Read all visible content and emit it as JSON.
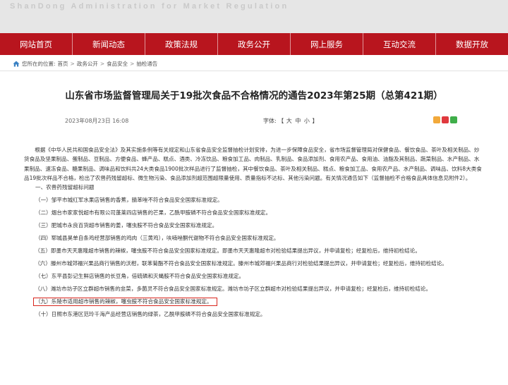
{
  "header": {
    "subtitle": "ShanDong Administration for Market Regulation"
  },
  "nav": {
    "items": [
      "网站首页",
      "新闻动态",
      "政策法规",
      "政务公开",
      "网上服务",
      "互动交流",
      "数据开放"
    ]
  },
  "breadcrumb": {
    "prefix": "您所在的位置:",
    "items": [
      "首页",
      "政务公开",
      "食品安全",
      "抽检通告"
    ],
    "separator": ">"
  },
  "article": {
    "title": "山东省市场监督管理局关于19批次食品不合格情况的通告2023年第25期（总第421期）",
    "date": "2023年08月23日 16:08",
    "font_label": "字体:",
    "font_open": "【",
    "font_large": "大",
    "font_medium": "中",
    "font_small": "小",
    "font_close": "】",
    "intro": "根据《中华人民共和国食品安全法》及其实施条例等有关规定和山东省食品安全监督抽检计划安排，为进一步保障食品安全，省市场监督管理局对保健食品、餐饮食品、茶叶及相关制品、炒货食品及坚果制品、蛋制品、豆制品、方便食品、蜂产品、糕点、酒类、冷冻饮品、粮食加工品、肉制品、乳制品、食品添加剂、食用农产品、食用油、油脂及其制品、蔬菜制品、水产制品、水果制品、速冻食品、糖果制品、调味品和饮料共24大类食品1900批次样品进行了监督抽检，其中餐饮食品、茶叶及相关制品、糕点、粮食加工品、食用农产品、水产制品、调味品、饮料8大类食品19批次样品不合格，检出了农兽药残留超标、微生物污染、食品添加剂超范围超限量使用、质量指标不达标、其他污染问题。有关情况通告如下（监督抽检不合格食品具体信息见附件2）。",
    "section1": "一、农兽药残留超标问题",
    "items": [
      "（一）邹平市城红军水果店销售的香蕉，腈苯唑不符合食品安全国家标准规定。",
      "（二）烟台市家家悦超市有限公司蓬莱四店销售的芒果，乙酰甲胺磷不符合食品安全国家标准规定。",
      "（三）肥城市永良百货超市销售的姜，噻虫胺不符合食品安全国家标准规定。",
      "（四）郓城县昊单自条鸡经营部销售的鸡肉（三黄鸡），呋喃唑酮代谢物不符合食品安全国家标准规定。",
      "（五）即墨市天天惠隆超市销售的辣椒，噻虫胺不符合食品安全国家标准规定。即墨市天天惠隆超市对检验结果提出异议，并申请复检；经复检后，维持初检结论。",
      "（六）滕州市城郊福兴果品商行销售的沃柑，联苯菊酯不符合食品安全国家标准规定。滕州市城郊福兴果品商行对检验结果提出异议，并申请复检；经复检后，维持初检结论。",
      "（七）东平县彭记生鲜店销售的长豆角，倍硫磷和灭蝇胺不符合食品安全国家标准规定。",
      "（八）潍坊市坊子区立群超市销售的韭菜，多菌灵不符合食品安全国家标准规定。潍坊市坊子区立群超市对检验结果提出异议，并申请复检；经复检后，维持初检结论。",
      "（九）乐陵市适用超市销售的辣椒，噻虫胺不符合食品安全国家标准规定。",
      "（十）日照市东港区范玲千海产品经营店销售的绿茶，乙酰甲胺磷不符合食品安全国家标准规定。"
    ]
  },
  "colors": {
    "nav_red": "#b8151e",
    "highlight_border": "#d9251d"
  }
}
